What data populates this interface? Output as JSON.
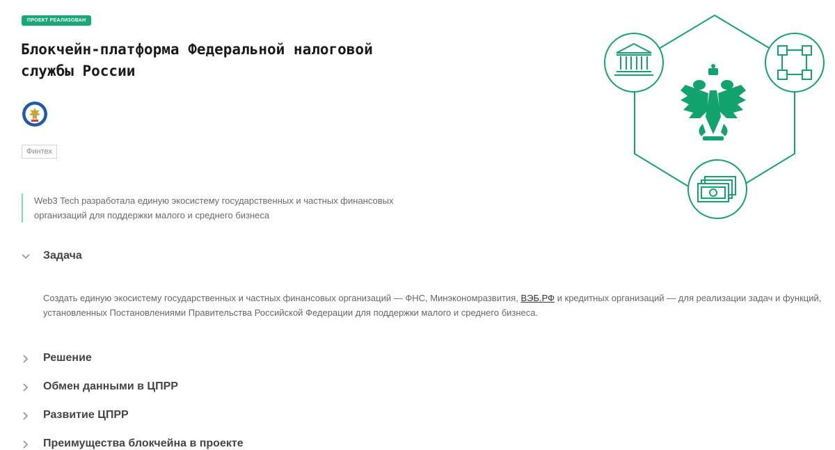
{
  "badge": "Проект реализован",
  "title": "Блокчейн-платформа Федеральной налоговой службы России",
  "tag": "Финтех",
  "lead": "Web3 Tech разработала единую экосистему государственных и частных финансовых организаций для поддержки малого и среднего бизнеса",
  "accordion": {
    "task": {
      "title": "Задача",
      "body_before": "Создать единую экосистему государственных и частных финансовых организаций — ФНС, Минэкономразвития, ",
      "link": "ВЭБ.РФ",
      "body_after": " и кредитных организаций — для реализации задач и функций, установленных Постановлениями Правительства Российской Федерации для поддержки малого и среднего бизнеса."
    },
    "solution": {
      "title": "Решение"
    },
    "exchange": {
      "title": "Обмен данными в ЦПРР"
    },
    "development": {
      "title": "Развитие ЦПРР"
    },
    "advantages": {
      "title": "Преимущества блокчейна в проекте"
    }
  },
  "colors": {
    "accent": "#1aa877",
    "icon": "#13a36e",
    "lead_border": "#7fd8b7"
  },
  "icons": [
    "fns-emblem-icon",
    "government-building-icon",
    "network-nodes-icon",
    "banknotes-icon",
    "double-headed-eagle-icon",
    "chevron-down-icon",
    "chevron-right-icon"
  ]
}
